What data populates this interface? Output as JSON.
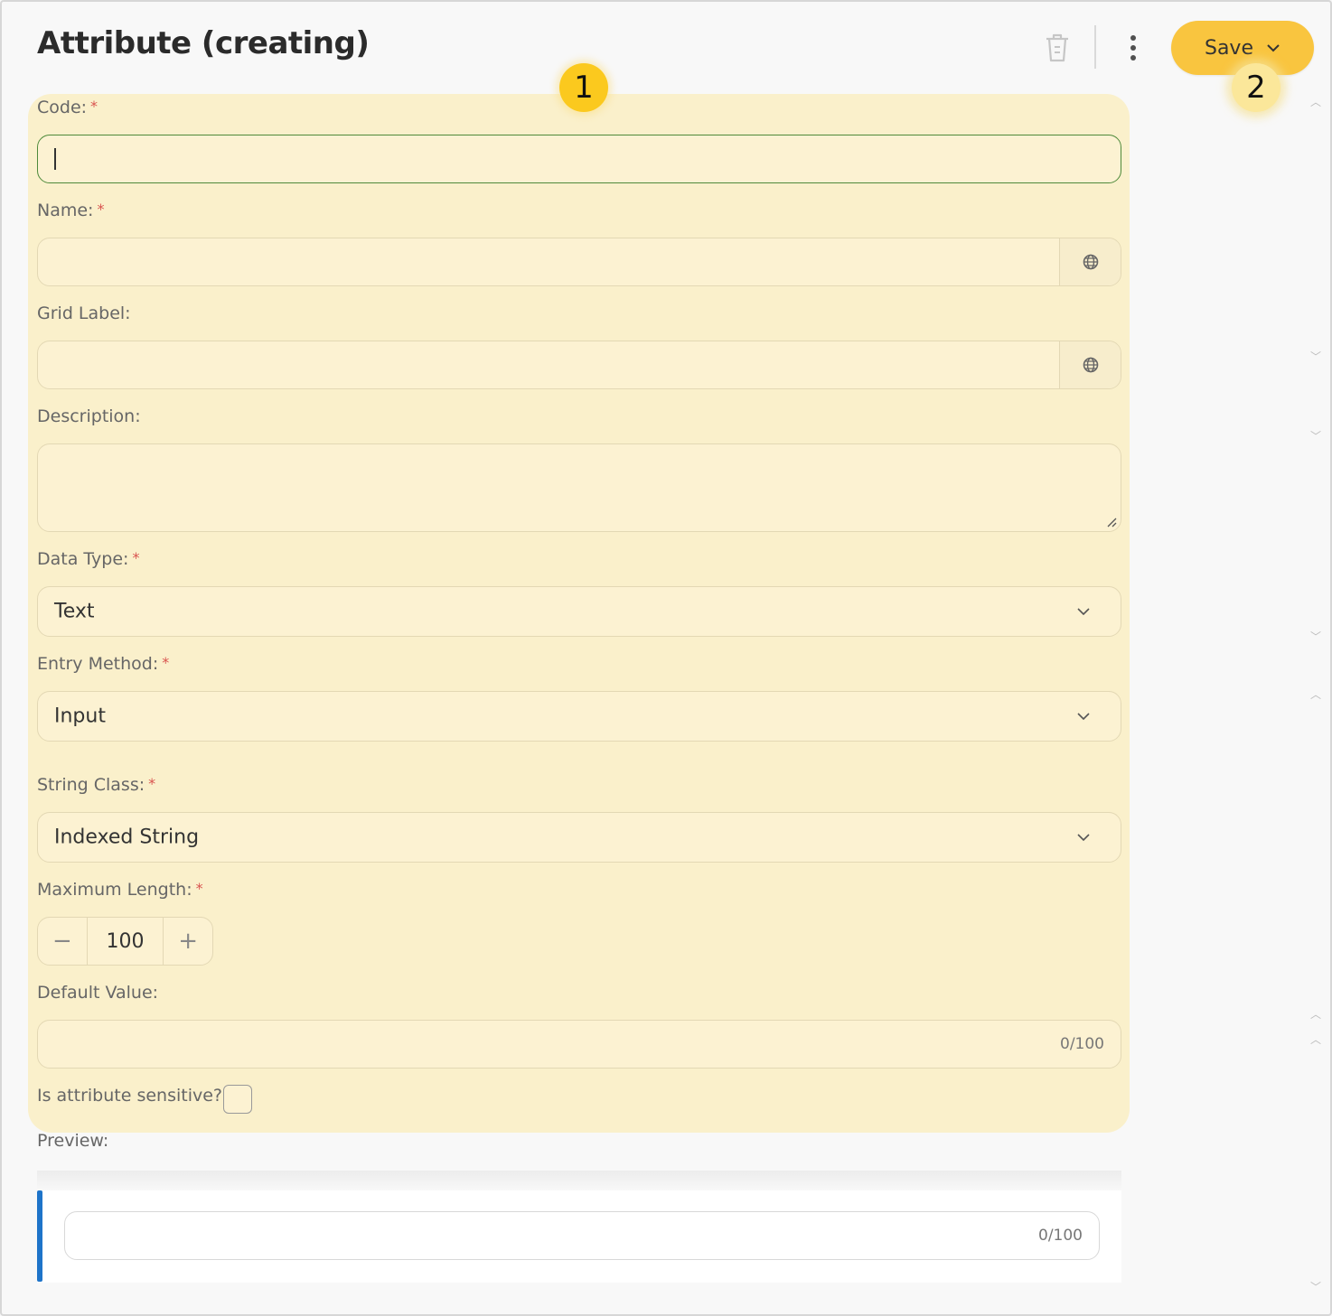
{
  "header": {
    "title": "Attribute (creating)",
    "save_label": "Save"
  },
  "annotations": {
    "badge_1": "1",
    "badge_2": "2"
  },
  "form": {
    "code": {
      "label": "Code:",
      "required_mark": "*",
      "value": ""
    },
    "name": {
      "label": "Name:",
      "required_mark": "*",
      "value": ""
    },
    "grid_label": {
      "label": "Grid Label:",
      "value": ""
    },
    "description": {
      "label": "Description:",
      "value": ""
    },
    "data_type": {
      "label": "Data Type:",
      "required_mark": "*",
      "selected": "Text"
    },
    "entry_method": {
      "label": "Entry Method:",
      "required_mark": "*",
      "selected": "Input"
    },
    "string_class": {
      "label": "String Class:",
      "required_mark": "*",
      "selected": "Indexed String"
    },
    "maximum_length": {
      "label": "Maximum Length:",
      "required_mark": "*",
      "value": "100",
      "decrement": "−",
      "increment": "+"
    },
    "default_value": {
      "label": "Default Value:",
      "counter": "0/100"
    },
    "sensitive": {
      "label": "Is attribute sensitive?",
      "checked": false
    }
  },
  "preview": {
    "label": "Preview:",
    "counter": "0/100"
  },
  "colors": {
    "accent": "#f9c53f",
    "highlight": "#faf0cb",
    "preview_accent": "#1e74c9",
    "required": "#d9534f"
  },
  "icons": [
    "trash-icon",
    "more-vertical-icon",
    "chevron-down-icon",
    "globe-icon",
    "resize-handle-icon"
  ]
}
